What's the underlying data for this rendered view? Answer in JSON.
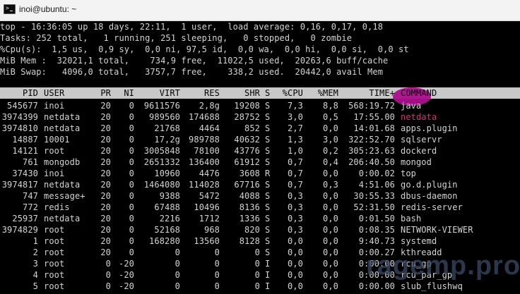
{
  "window": {
    "title": "inoi@ubuntu: ~"
  },
  "summary": [
    "top - 16:36:05 up 18 days, 22:11,  1 user,  load average: 0,16, 0,17, 0,18",
    "Tasks: 252 total,   1 running, 251 sleeping,   0 stopped,   0 zombie",
    "%Cpu(s):  1,5 us,  0,9 sy,  0,0 ni, 97,5 id,  0,0 wa,  0,0 hi,  0,0 si,  0,0 st",
    "MiB Mem :  32021,1 total,    734,9 free,  11022,5 used,  20263,6 buff/cache",
    "MiB Swap:   4096,0 total,   3757,7 free,    338,2 used.  20442,0 avail Mem"
  ],
  "columns": [
    "PID",
    "USER",
    "PR",
    "NI",
    "VIRT",
    "RES",
    "SHR",
    "S",
    "%CPU",
    "%MEM",
    "TIME+",
    "COMMAND"
  ],
  "processes": [
    [
      "545677",
      "inoi",
      "20",
      "0",
      "9611576",
      "2,8g",
      "19208",
      "S",
      "7,3",
      "8,8",
      "568:19.72",
      "java"
    ],
    [
      "3974399",
      "netdata",
      "20",
      "0",
      "989560",
      "174688",
      "28752",
      "S",
      "3,0",
      "0,5",
      "17:55.00",
      "netdata"
    ],
    [
      "3974810",
      "netdata",
      "20",
      "0",
      "21768",
      "4464",
      "852",
      "S",
      "2,7",
      "0,0",
      "14:01.68",
      "apps.plugin"
    ],
    [
      "14887",
      "10001",
      "20",
      "0",
      "17,2g",
      "989788",
      "40632",
      "S",
      "1,3",
      "3,0",
      "322:52.70",
      "sqlservr"
    ],
    [
      "14121",
      "root",
      "20",
      "0",
      "3005848",
      "78100",
      "43776",
      "S",
      "1,0",
      "0,2",
      "305:23.63",
      "dockerd"
    ],
    [
      "761",
      "mongodb",
      "20",
      "0",
      "2651332",
      "136400",
      "61912",
      "S",
      "0,7",
      "0,4",
      "206:40.50",
      "mongod"
    ],
    [
      "37430",
      "inoi",
      "20",
      "0",
      "10960",
      "4476",
      "3608",
      "R",
      "0,7",
      "0,0",
      "0:00.02",
      "top"
    ],
    [
      "3974817",
      "netdata",
      "20",
      "0",
      "1464080",
      "114028",
      "67716",
      "S",
      "0,7",
      "0,3",
      "4:51.06",
      "go.d.plugin"
    ],
    [
      "747",
      "message+",
      "20",
      "0",
      "9388",
      "5472",
      "4088",
      "S",
      "0,3",
      "0,0",
      "30:55.33",
      "dbus-daemon"
    ],
    [
      "772",
      "redis",
      "20",
      "0",
      "67488",
      "10496",
      "8136",
      "S",
      "0,3",
      "0,0",
      "52:31.50",
      "redis-server"
    ],
    [
      "25937",
      "netdata",
      "20",
      "0",
      "2216",
      "1712",
      "1336",
      "S",
      "0,3",
      "0,0",
      "0:01.50",
      "bash"
    ],
    [
      "3974829",
      "root",
      "20",
      "0",
      "52168",
      "968",
      "820",
      "S",
      "0,3",
      "0,0",
      "0:08.35",
      "NETWORK-VIEWER"
    ],
    [
      "1",
      "root",
      "20",
      "0",
      "168280",
      "13560",
      "8128",
      "S",
      "0,0",
      "0,0",
      "9:40.73",
      "systemd"
    ],
    [
      "2",
      "root",
      "20",
      "0",
      "0",
      "0",
      "0",
      "S",
      "0,0",
      "0,0",
      "0:00.27",
      "kthreadd"
    ],
    [
      "3",
      "root",
      "0",
      "-20",
      "0",
      "0",
      "0",
      "I",
      "0,0",
      "0,0",
      "0:00.00",
      "rcu_gp"
    ],
    [
      "4",
      "root",
      "0",
      "-20",
      "0",
      "0",
      "0",
      "I",
      "0,0",
      "0,0",
      "0:00.00",
      "rcu_par_gp"
    ],
    [
      "5",
      "root",
      "0",
      "-20",
      "0",
      "0",
      "0",
      "I",
      "0,0",
      "0,0",
      "0:00.00",
      "slub_flushwq"
    ]
  ],
  "watermark": "ragemp.pro",
  "colors": {
    "background": "#000000",
    "text": "#d4d4d4",
    "header_bar": "#c8c8c8",
    "netdata_highlight": "#c73a73",
    "blob": "#ab0f8c"
  }
}
